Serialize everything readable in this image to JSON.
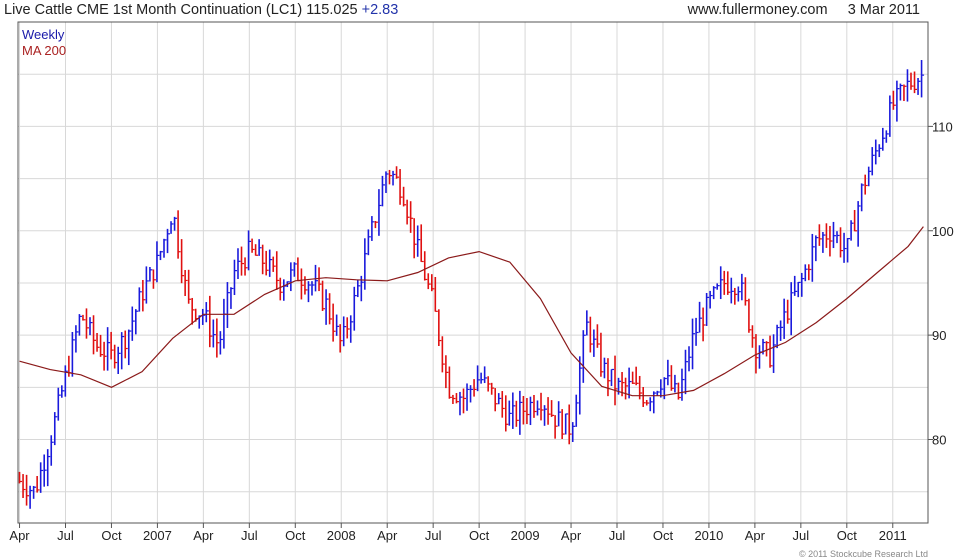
{
  "header": {
    "title": "Live Cattle CME 1st Month Continuation (LC1)",
    "price": "115.025",
    "change": "+2.83",
    "site": "www.fullermoney.com",
    "date": "3 Mar 2011"
  },
  "legend": {
    "series1": "Weekly",
    "series2": "MA 200"
  },
  "copyright": "© 2011 Stockcube Research Ltd",
  "colors": {
    "up": "#1a1adc",
    "down": "#e01010",
    "ma": "#8b1a1a",
    "grid": "#d8d8d8",
    "frame": "#555555"
  },
  "chart_data": {
    "type": "line",
    "subtype": "weekly price bars with 200-period moving average",
    "y_axis": {
      "side": "right",
      "range": [
        72,
        120
      ],
      "ticks": [
        80,
        90,
        100,
        110
      ]
    },
    "x_ticks": [
      "Apr",
      "Jul",
      "Oct",
      "2007",
      "Apr",
      "Jul",
      "Oct",
      "2008",
      "Apr",
      "Jul",
      "Oct",
      "2009",
      "Apr",
      "Jul",
      "Oct",
      "2010",
      "Apr",
      "Jul",
      "Oct",
      "2011"
    ],
    "grid": true,
    "series": [
      {
        "name": "Weekly",
        "style": "price-bars",
        "x": [
          "2006-04",
          "2006-05",
          "2006-06",
          "2006-07",
          "2006-08",
          "2006-09",
          "2006-10",
          "2006-11",
          "2006-12",
          "2007-01",
          "2007-02",
          "2007-03",
          "2007-04",
          "2007-05",
          "2007-06",
          "2007-07",
          "2007-08",
          "2007-09",
          "2007-10",
          "2007-11",
          "2007-12",
          "2008-01",
          "2008-02",
          "2008-03",
          "2008-04",
          "2008-05",
          "2008-06",
          "2008-07",
          "2008-08",
          "2008-09",
          "2008-10",
          "2008-11",
          "2008-12",
          "2009-01",
          "2009-02",
          "2009-03",
          "2009-04",
          "2009-05",
          "2009-06",
          "2009-07",
          "2009-08",
          "2009-09",
          "2009-10",
          "2009-11",
          "2009-12",
          "2010-01",
          "2010-02",
          "2010-03",
          "2010-04",
          "2010-05",
          "2010-06",
          "2010-07",
          "2010-08",
          "2010-09",
          "2010-10",
          "2010-11",
          "2010-12",
          "2011-01",
          "2011-02",
          "2011-03"
        ],
        "values": [
          76,
          75,
          80,
          86,
          92,
          89,
          88,
          90,
          94,
          97,
          102,
          93,
          92,
          89,
          96,
          98,
          97,
          95,
          96,
          95,
          93,
          89,
          94,
          100,
          106,
          104,
          98,
          93,
          85,
          84,
          86,
          84,
          82,
          83,
          84,
          82,
          81,
          91,
          87,
          85,
          85,
          84,
          86,
          84,
          90,
          93,
          95,
          95,
          89,
          88,
          92,
          95,
          99,
          100,
          98,
          104,
          108,
          112,
          114,
          115
        ]
      },
      {
        "name": "MA 200",
        "style": "line",
        "x": [
          "2006-04",
          "2006-06",
          "2006-08",
          "2006-10",
          "2006-12",
          "2007-02",
          "2007-04",
          "2007-06",
          "2007-08",
          "2007-10",
          "2007-12",
          "2008-02",
          "2008-04",
          "2008-06",
          "2008-08",
          "2008-10",
          "2008-12",
          "2009-02",
          "2009-04",
          "2009-06",
          "2009-08",
          "2009-10",
          "2009-12",
          "2010-02",
          "2010-04",
          "2010-06",
          "2010-08",
          "2010-10",
          "2010-12",
          "2011-02",
          "2011-03"
        ],
        "values": [
          87.5,
          86.7,
          86.2,
          85.0,
          86.5,
          89.7,
          92.0,
          92.0,
          93.9,
          95.2,
          95.5,
          95.3,
          95.2,
          96.0,
          97.4,
          98.0,
          97.0,
          93.5,
          88.3,
          85.1,
          84.2,
          84.2,
          84.7,
          86.3,
          88.1,
          89.3,
          91.2,
          93.5,
          96.0,
          98.5,
          100.4
        ]
      }
    ]
  }
}
